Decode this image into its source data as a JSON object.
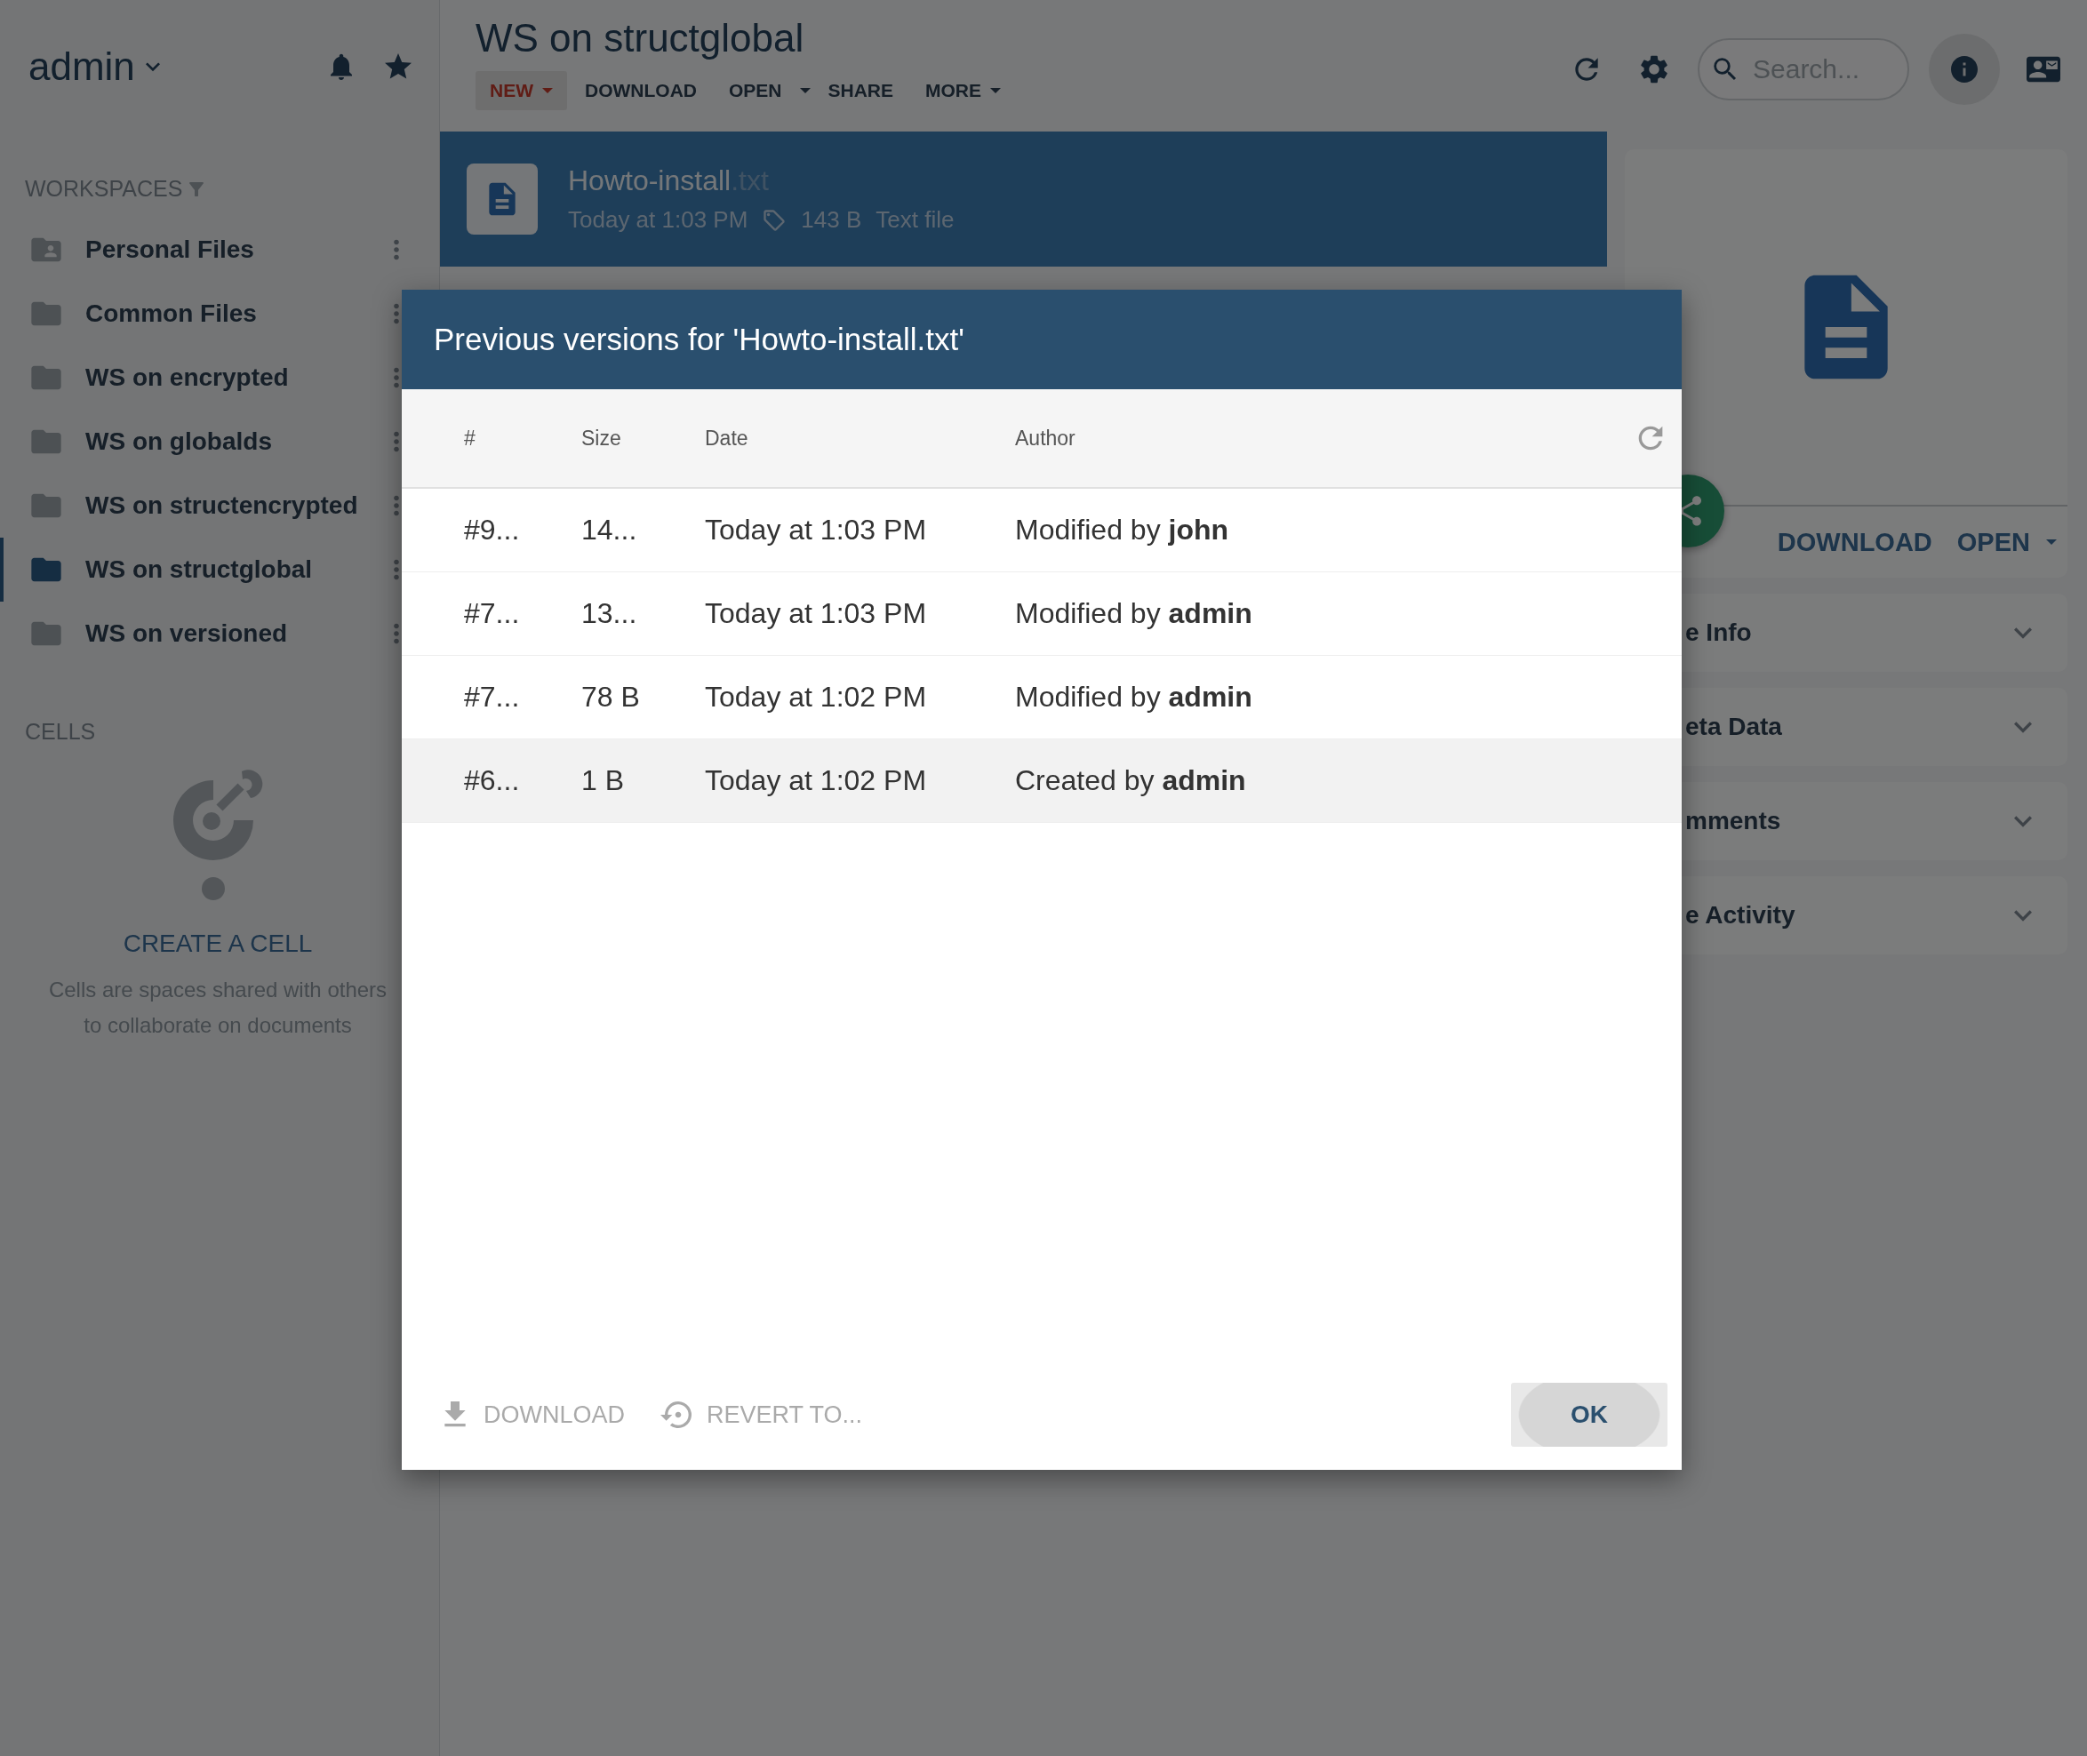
{
  "user": {
    "name": "admin"
  },
  "sidebar": {
    "section_title": "WORKSPACES",
    "items": [
      {
        "label": "Personal Files",
        "kind": "personal",
        "selected": false
      },
      {
        "label": "Common Files",
        "kind": "folder",
        "selected": false
      },
      {
        "label": "WS on encrypted",
        "kind": "folder",
        "selected": false
      },
      {
        "label": "WS on globalds",
        "kind": "folder",
        "selected": false
      },
      {
        "label": "WS on structencrypted",
        "kind": "folder",
        "selected": false
      },
      {
        "label": "WS on structglobal",
        "kind": "folder",
        "selected": true
      },
      {
        "label": "WS on versioned",
        "kind": "folder",
        "selected": false
      }
    ],
    "cells_title": "CELLS",
    "create_cell": "CREATE A CELL",
    "cells_description": "Cells are spaces shared with others to collaborate on documents"
  },
  "workspace": {
    "title": "WS on structglobal",
    "toolbar": [
      {
        "label": "NEW",
        "kind": "primary"
      },
      {
        "label": "DOWNLOAD",
        "kind": "plain"
      },
      {
        "label": "OPEN",
        "kind": "split"
      },
      {
        "label": "SHARE",
        "kind": "plain"
      },
      {
        "label": "MORE",
        "kind": "menu"
      }
    ],
    "search": {
      "placeholder": "Search..."
    }
  },
  "file": {
    "name": "Howto-install",
    "extension": ".txt",
    "modified": "Today at 1:03 PM",
    "size": "143 B",
    "type": "Text file",
    "selected": true
  },
  "details": {
    "actions": [
      "DOWNLOAD",
      "OPEN"
    ],
    "sections": [
      {
        "title": "e Info",
        "expanded": false
      },
      {
        "title": "eta Data",
        "expanded": false
      },
      {
        "title": "mments",
        "expanded": false
      },
      {
        "title": "e Activity",
        "expanded": false
      }
    ]
  },
  "dialog": {
    "title": "Previous versions for 'Howto-install.txt'",
    "columns": [
      "#",
      "Size",
      "Date",
      "Author"
    ],
    "rows": [
      {
        "cells": [
          "#9...",
          "14...",
          "Today at 1:03 PM",
          "Modified by **john**"
        ],
        "selected": false
      },
      {
        "cells": [
          "#7...",
          "13...",
          "Today at 1:03 PM",
          "Modified by **admin**"
        ],
        "selected": false
      },
      {
        "cells": [
          "#7...",
          "78 B",
          "Today at 1:02 PM",
          "Modified by **admin**"
        ],
        "selected": false
      },
      {
        "cells": [
          "#6...",
          "1 B",
          "Today at 1:02 PM",
          "Created by **admin**"
        ],
        "selected": true
      }
    ],
    "actions": [
      {
        "label": "DOWNLOAD",
        "kind": "download",
        "disabled": true
      },
      {
        "label": "REVERT TO...",
        "kind": "revert",
        "disabled": true
      }
    ],
    "ok": "OK"
  }
}
